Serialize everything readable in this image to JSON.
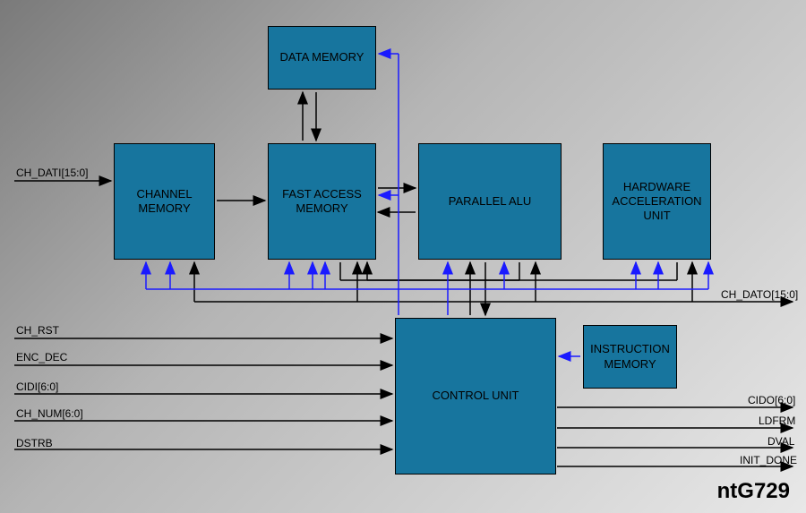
{
  "title": "ntG729",
  "blocks": {
    "data_memory": "DATA MEMORY",
    "channel_memory": "CHANNEL MEMORY",
    "fast_access_memory": "FAST ACCESS MEMORY",
    "parallel_alu": "PARALLEL ALU",
    "hw_accel": "HARDWARE ACCELERATION UNIT",
    "control_unit": "CONTROL UNIT",
    "instruction_memory": "INSTRUCTION MEMORY"
  },
  "signals": {
    "ch_dati": "CH_DATI[15:0]",
    "ch_rst": "CH_RST",
    "enc_dec": "ENC_DEC",
    "cidi": "CIDI[6:0]",
    "ch_num": "CH_NUM[6:0]",
    "dstrb": "DSTRB",
    "ch_dato": "CH_DATO[15:0]",
    "cido": "CIDO[6:0]",
    "ldfrm": "LDFRM",
    "dval": "DVAL",
    "init_done": "INIT_DONE"
  }
}
